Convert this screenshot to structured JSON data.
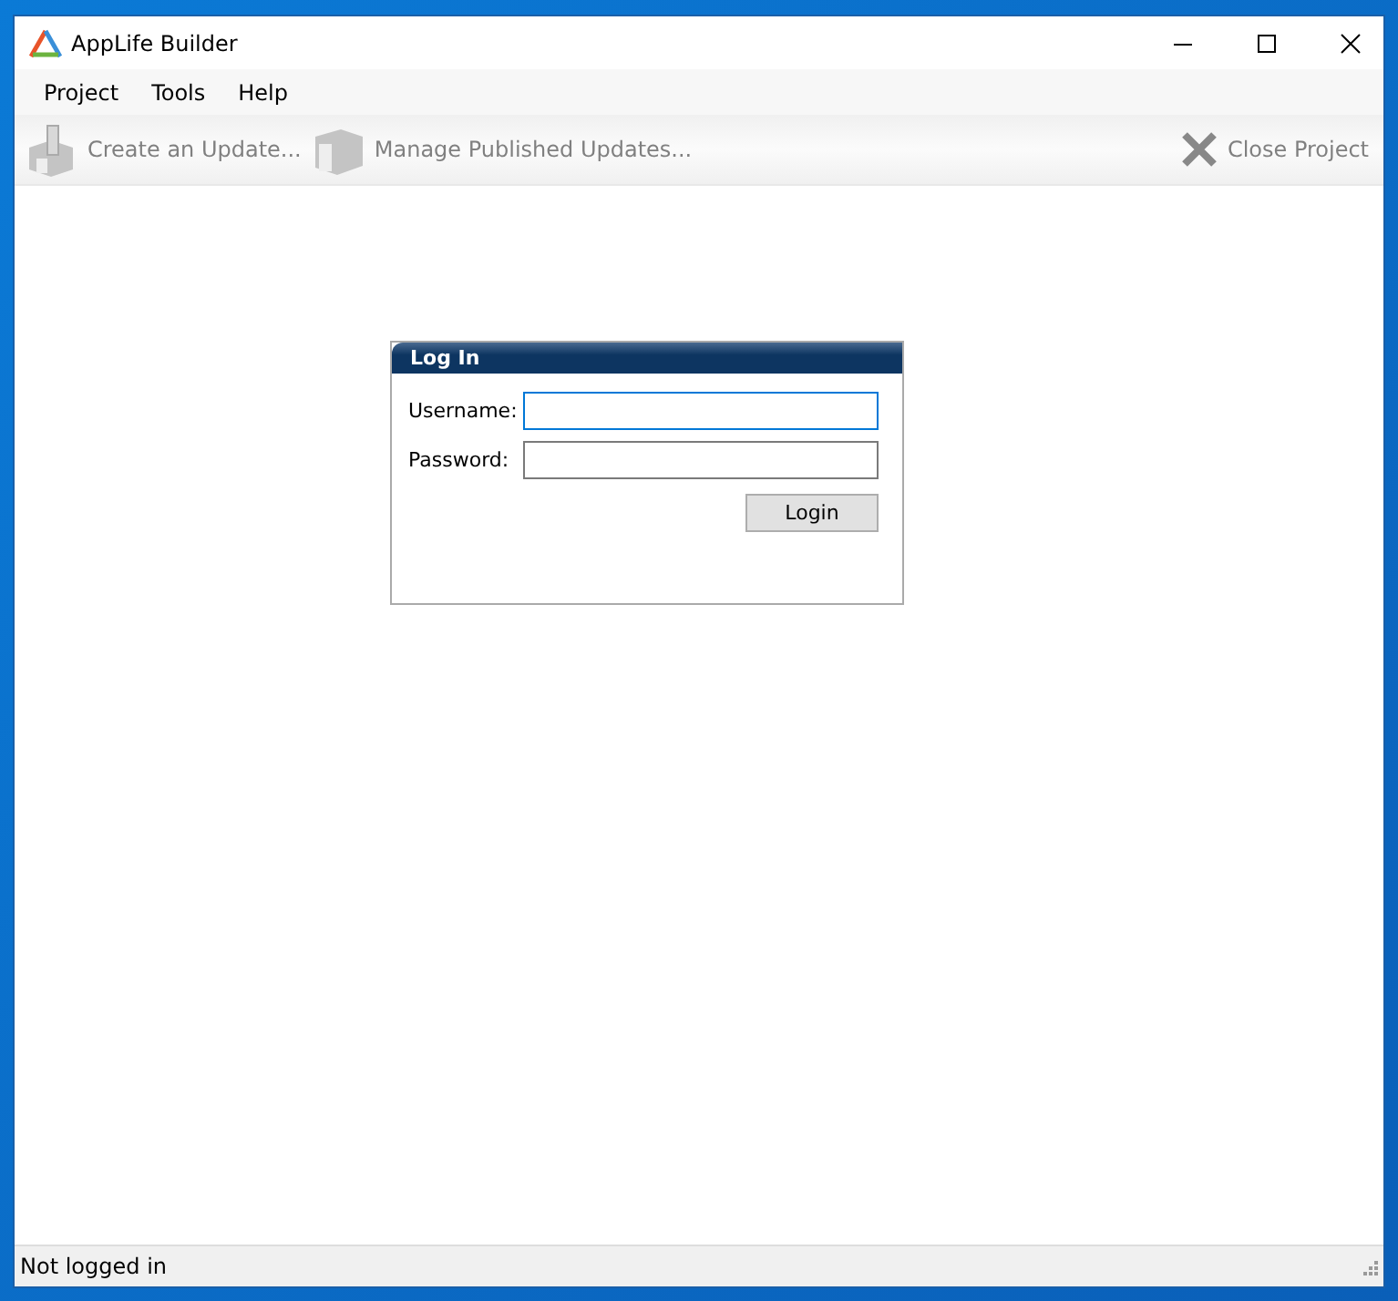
{
  "window": {
    "title": "AppLife Builder"
  },
  "menu": [
    {
      "label": "Project"
    },
    {
      "label": "Tools"
    },
    {
      "label": "Help"
    }
  ],
  "toolbar": [
    {
      "label": "Create an Update...",
      "kind": "create",
      "disabled": true
    },
    {
      "label": "Manage Published Updates...",
      "kind": "manage",
      "disabled": true
    },
    {
      "label": "Close Project",
      "kind": "close",
      "disabled": true
    }
  ],
  "login_panel": {
    "title": "Log In",
    "fields": [
      {
        "label": "Username:",
        "focused": true
      },
      {
        "label": "Password:",
        "focused": false
      }
    ],
    "button": "Login"
  },
  "status_bar": {
    "text": "Not logged in"
  }
}
